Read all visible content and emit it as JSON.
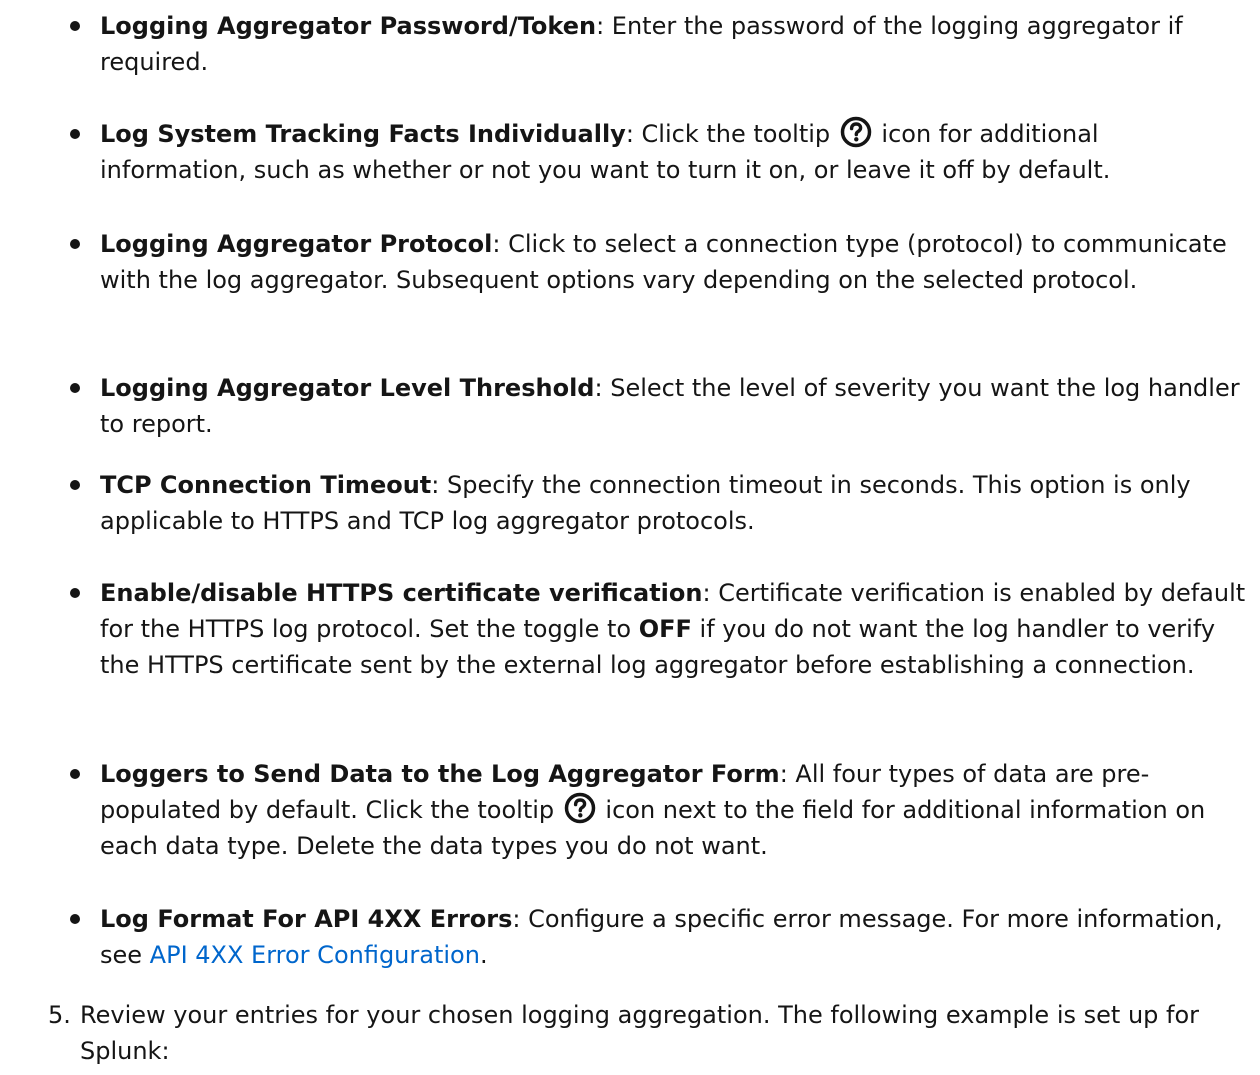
{
  "items": [
    {
      "term": "Logging Aggregator Password/Token",
      "sep": ": ",
      "text": "Enter the password of the logging aggregator if required."
    },
    {
      "term": "Log System Tracking Facts Individually",
      "sep": ": ",
      "text_before": "Click the tooltip ",
      "icon": "question-circle-icon",
      "text_after": " icon for additional information, such as whether or not you want to turn it on, or leave it off by default."
    },
    {
      "term": "Logging Aggregator Protocol",
      "sep": ": ",
      "text": "Click to select a connection type (protocol) to communicate with the log aggregator. Subsequent options vary depending on the selected protocol."
    },
    {
      "term": "Logging Aggregator Level Threshold",
      "sep": ": ",
      "text": "Select the level of severity you want the log handler to report."
    },
    {
      "term": "TCP Connection Timeout",
      "sep": ": ",
      "text": "Specify the connection timeout in seconds. This option is only applicable to HTTPS and TCP log aggregator protocols."
    },
    {
      "term": "Enable/disable HTTPS certificate verification",
      "sep": ": ",
      "text_before": "Certificate verification is enabled by default for the HTTPS log protocol. Set the toggle to ",
      "strong": "OFF",
      "text_after": " if you do not want the log handler to verify the HTTPS certificate sent by the external log aggregator before establishing a connection."
    },
    {
      "term": "Loggers to Send Data to the Log Aggregator Form",
      "sep": ": ",
      "text_before": "All four types of data are pre-populated by default. Click the tooltip ",
      "icon": "question-circle-icon",
      "text_after": " icon next to the field for additional information on each data type. Delete the data types you do not want."
    },
    {
      "term": "Log Format For API 4XX Errors",
      "sep": ": ",
      "text_before": "Configure a specific error message. For more information, see ",
      "link": "API 4XX Error Configuration",
      "text_after": "."
    }
  ],
  "step": {
    "number": "5.",
    "text": "Review your entries for your chosen logging aggregation. The following example is set up for Splunk:"
  },
  "colors": {
    "text": "#151515",
    "link": "#0066cc"
  }
}
